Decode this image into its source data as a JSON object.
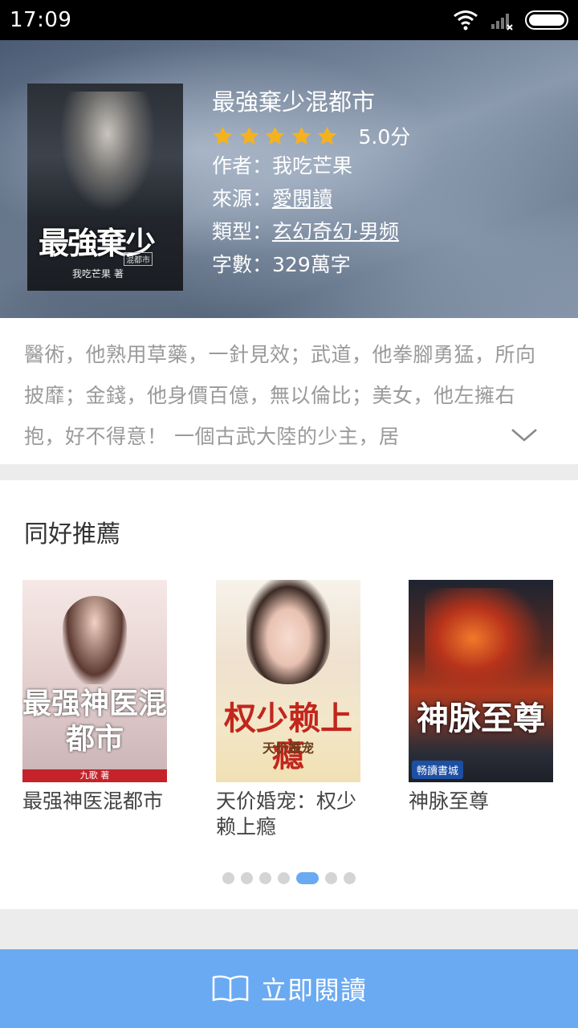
{
  "status_bar": {
    "time": "17:09"
  },
  "book": {
    "title": "最強棄少混都市",
    "rating": 5.0,
    "rating_text": "5.0分",
    "author_label": "作者：",
    "author": "我吃芒果",
    "source_label": "來源：",
    "source": "愛閱讀",
    "genre_label": "類型：",
    "genre": "玄幻奇幻·男频",
    "words_label": "字數：",
    "words": "329萬字",
    "cover_title": "最強棄少",
    "cover_subtitle": "混都市",
    "cover_author": "我吃芒果 著"
  },
  "synopsis": {
    "text": "醫術，他熟用草藥，一針見效；武道，他拳腳勇猛，所向披靡；金錢，他身價百億，無以倫比；美女，他左擁右抱，好不得意！ 一個古武大陸的少主，居"
  },
  "recommendations": {
    "title": "同好推薦",
    "items": [
      {
        "name": "最强神医混都市",
        "cover_text": "最强神医混都市",
        "cover_author": "九歌 著"
      },
      {
        "name": "天价婚宠：权少赖上瘾",
        "cover_text": "权少赖上瘾",
        "cover_sub": "天价婚宠"
      },
      {
        "name": "神脉至尊",
        "cover_text": "神脉至尊",
        "cover_badge": "畅讀書城"
      }
    ],
    "page_count": 7,
    "active_page": 4
  },
  "read_button": {
    "label": "立即閱讀",
    "icon": "open-book-icon"
  },
  "colors": {
    "accent": "#6aaaf2",
    "star": "#f5b21f"
  }
}
